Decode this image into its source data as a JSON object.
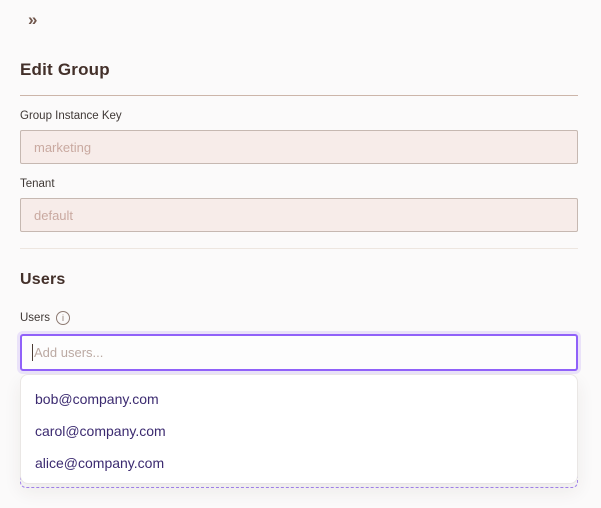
{
  "colors": {
    "page_background": "#fbfafa",
    "heading_text": "#43302a",
    "accent_focus_purple": "#9061f9",
    "option_text_purple": "#3b2a70",
    "dashed_border_purple": "#a583f2",
    "disabled_field_background": "#f7ece9",
    "disabled_field_text": "#c9a9a0",
    "strong_divider": "#ccb5a9"
  },
  "header": {
    "collapse_icon": "»",
    "title": "Edit Group"
  },
  "form": {
    "fields": [
      {
        "label": "Group Instance Key",
        "value": "marketing"
      },
      {
        "label": "Tenant",
        "value": "default"
      }
    ]
  },
  "users": {
    "section_heading": "Users",
    "field_label": "Users",
    "info_icon_glyph": "i",
    "placeholder": "Add users...",
    "options": [
      "bob@company.com",
      "carol@company.com",
      "alice@company.com"
    ]
  }
}
